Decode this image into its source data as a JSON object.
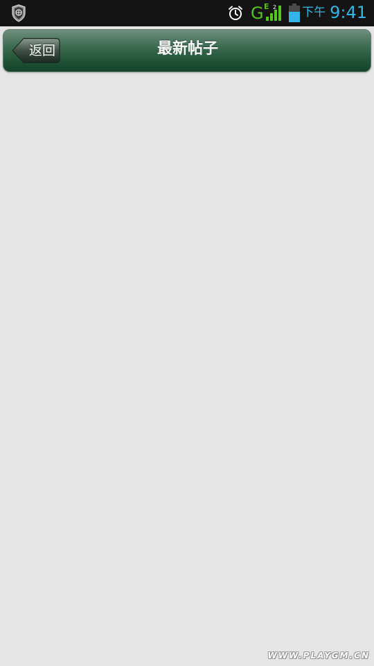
{
  "status_bar": {
    "network_type": "G",
    "network_sub": "E",
    "network_sub_index": "2",
    "time_period": "下午",
    "time": "9:41",
    "icons": [
      "shield-icon",
      "alarm-icon",
      "signal-icon",
      "battery-icon"
    ],
    "colors": {
      "network": "#55c51f",
      "clock": "#31b6e7",
      "battery": "#31b6e7"
    }
  },
  "header": {
    "back_label": "返回",
    "title": "最新帖子",
    "colors": {
      "top": "#6f8f7e",
      "bottom": "#15432b"
    }
  },
  "watermark": "WWW.PLAYGM.CN"
}
